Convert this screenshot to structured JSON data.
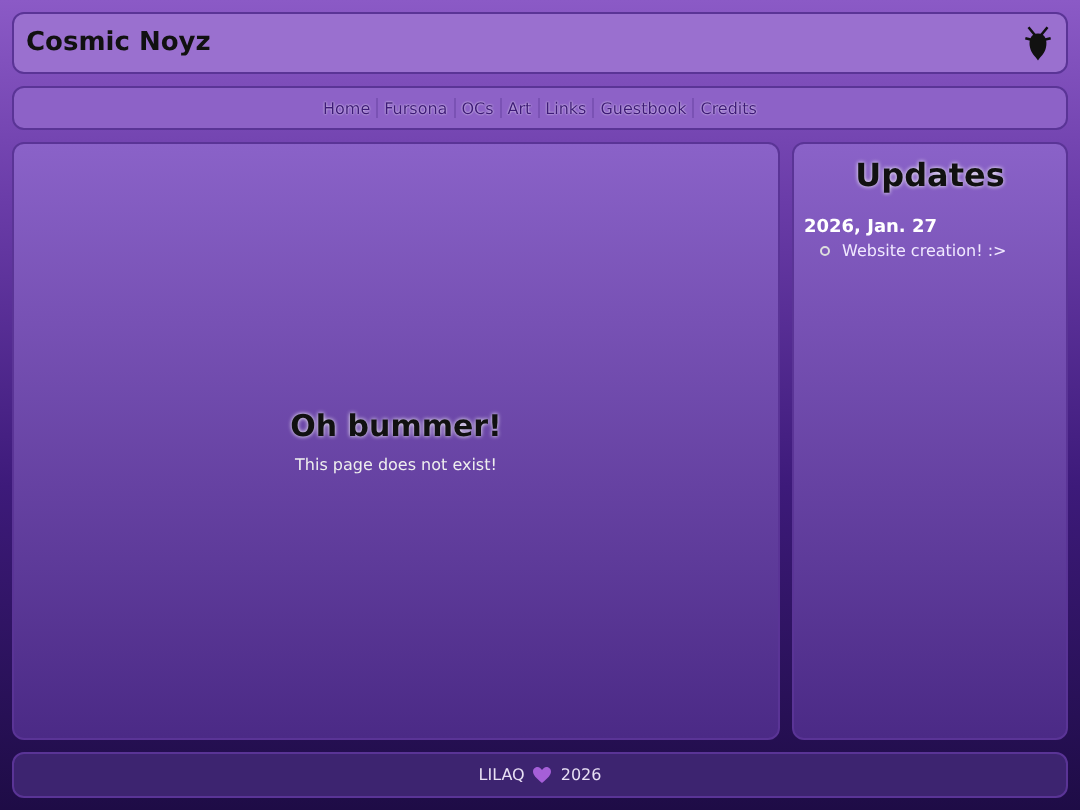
{
  "header": {
    "title": "Cosmic Noyz"
  },
  "nav": [
    "Home",
    "Fursona",
    "OCs",
    "Art",
    "Links",
    "Guestbook",
    "Credits"
  ],
  "main": {
    "heading": "Oh bummer!",
    "message": "This page does not exist!"
  },
  "updates": {
    "title": "Updates",
    "entries": [
      {
        "date": "2026, Jan. 27",
        "items": [
          "Website creation! :>"
        ]
      }
    ]
  },
  "footer": {
    "name": "LILAQ",
    "year": "2026"
  }
}
